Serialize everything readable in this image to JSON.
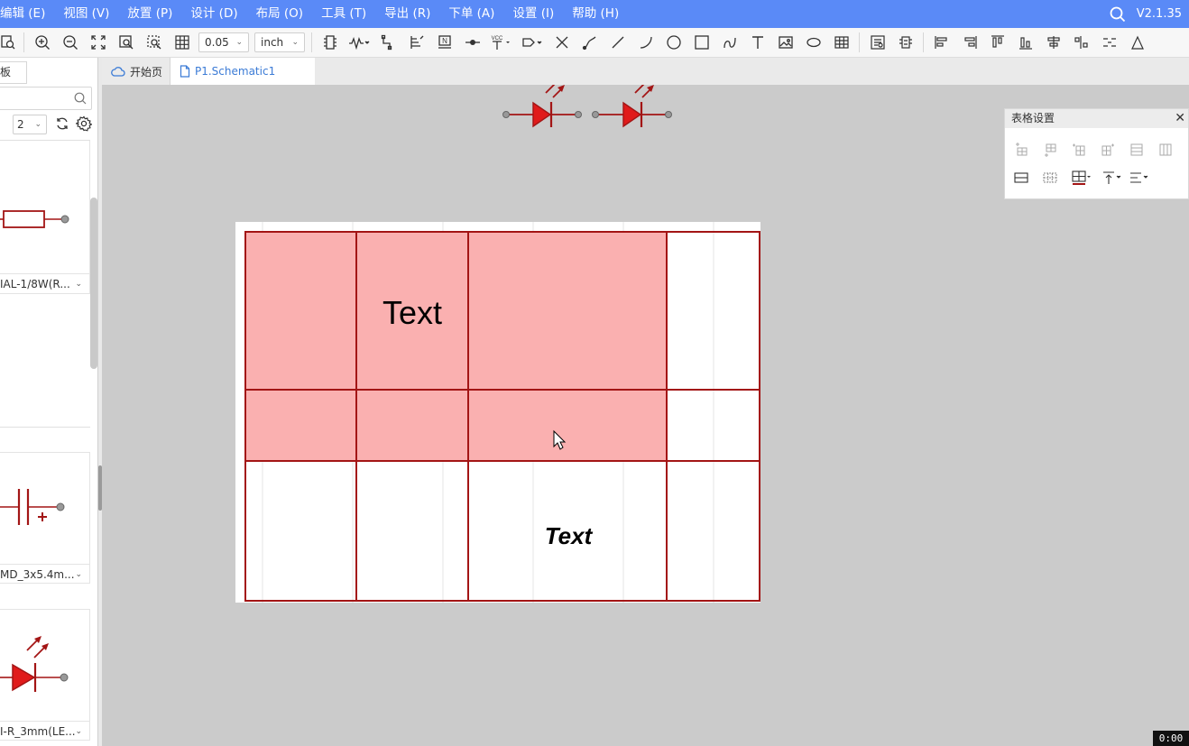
{
  "menubar": {
    "items": [
      {
        "label": "编辑 (E)"
      },
      {
        "label": "视图 (V)"
      },
      {
        "label": "放置 (P)"
      },
      {
        "label": "设计 (D)"
      },
      {
        "label": "布局 (O)"
      },
      {
        "label": "工具 (T)"
      },
      {
        "label": "导出 (R)"
      },
      {
        "label": "下单 (A)"
      },
      {
        "label": "设置 (I)"
      },
      {
        "label": "帮助 (H)"
      }
    ],
    "version": "V2.1.35"
  },
  "toolbar": {
    "grid_size": "0.05",
    "unit": "inch",
    "vcc_label": "VCC",
    "net_label": "N"
  },
  "left_panel": {
    "tab_label": "板",
    "page_value": "2",
    "components": [
      {
        "label": "IAL-1/8W(R...",
        "kind": "resistor"
      },
      {
        "label": "MD_3x5.4m...",
        "kind": "polarized-capacitor"
      },
      {
        "label": "I-R_3mm(LE...",
        "kind": "led"
      }
    ]
  },
  "tabs": [
    {
      "label": "开始页",
      "icon": "cloud-icon"
    },
    {
      "label": "P1.Schematic1",
      "icon": "document-icon"
    }
  ],
  "table_panel": {
    "title": "表格设置"
  },
  "canvas": {
    "table_cells": {
      "top_text": "Text",
      "bottom_text": "Text"
    }
  },
  "recording_time": "0:00",
  "colors": {
    "menubar_bg": "#5a8af7",
    "schematic_red": "#a31515",
    "selection_fill": "#fab0b0",
    "led_fill": "#e01b1b"
  }
}
